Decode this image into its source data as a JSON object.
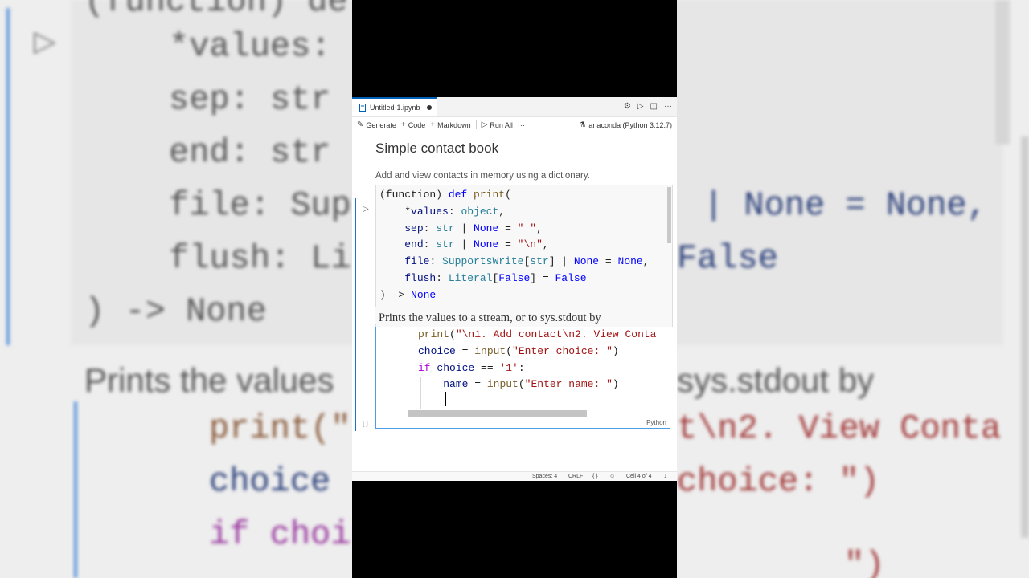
{
  "background": {
    "left_lines": [
      "(function) de",
      "*values:",
      "sep: str",
      "end: str",
      "file: Sup",
      "flush: Li",
      ") -> None",
      "Prints the values",
      "print(\"",
      "choice",
      "if choi"
    ],
    "right_lines": [
      "| None = None,",
      "False",
      "sys.stdout by",
      "t\\n2. View Conta",
      "choice: \")",
      "\")"
    ]
  },
  "editor": {
    "tab_title": "Untitled-1.ipynb",
    "toolbar": {
      "generate": "Generate",
      "code": "Code",
      "markdown": "Markdown",
      "run_all": "Run All",
      "more": "···",
      "kernel": "anaconda (Python 3.12.7)"
    },
    "markdown_cell": {
      "title": "Simple contact book",
      "description": "Add and view contacts in memory using a dictionary."
    },
    "hover": {
      "doc": "Prints the values to a stream, or to sys.stdout by"
    },
    "code_cell": {
      "language": "Python",
      "exec_count": "[ ]"
    },
    "statusbar": {
      "spaces": "Spaces: 4",
      "eol": "CRLF",
      "braces": "{ }",
      "cell": "Cell 4 of 4"
    }
  }
}
